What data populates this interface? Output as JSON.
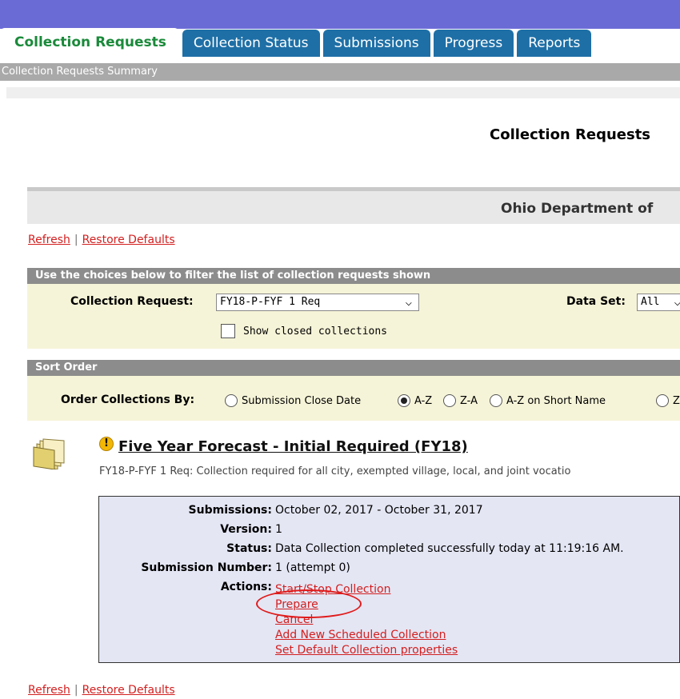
{
  "tabs": [
    {
      "label": "Collection Requests",
      "active": true
    },
    {
      "label": "Collection Status",
      "active": false
    },
    {
      "label": "Submissions",
      "active": false
    },
    {
      "label": "Progress",
      "active": false
    },
    {
      "label": "Reports",
      "active": false
    }
  ],
  "subnav": {
    "label": "Collection Requests Summary"
  },
  "page": {
    "title": "Collection Requests",
    "organization": "Ohio Department of"
  },
  "links": {
    "refresh": "Refresh",
    "separator": "|",
    "restore_defaults": "Restore Defaults"
  },
  "filter": {
    "header": "Use the choices below to filter the list of collection requests shown",
    "collection_request_label": "Collection Request:",
    "collection_request_value": "FY18-P-FYF 1 Req",
    "data_set_label": "Data Set:",
    "data_set_value": "All",
    "show_closed_label": "Show closed collections"
  },
  "sort": {
    "header": "Sort Order",
    "order_label": "Order Collections By:",
    "options": [
      "Submission Close Date",
      "A-Z",
      "Z-A",
      "A-Z on Short Name",
      "Z-"
    ],
    "selected": "A-Z"
  },
  "collection": {
    "title": "Five Year Forecast - Initial Required (FY18)",
    "description": "FY18-P-FYF 1 Req: Collection required for all city, exempted village, local, and joint vocatio",
    "details": [
      {
        "label": "Submissions:",
        "value": "October 02, 2017 - October 31, 2017"
      },
      {
        "label": "Version:",
        "value": "1"
      },
      {
        "label": "Status:",
        "value": "Data Collection completed successfully today at 11:19:16 AM."
      },
      {
        "label": "Submission Number:",
        "value": "1 (attempt 0)"
      },
      {
        "label": "Actions:",
        "value": ""
      }
    ],
    "actions": [
      "Start/Stop Collection",
      "Prepare",
      "Cancel",
      "Add New Scheduled Collection",
      "Set Default Collection properties"
    ]
  },
  "colors": {
    "link": "#d32020",
    "tab": "#1e6fa6",
    "active_tab_text": "#1a8a3a",
    "highlight": "#e01b1b",
    "warning": "#f2b705"
  },
  "icons": {
    "folder": "folder-icon",
    "warning": "warning-icon",
    "chevron": "chevron-down-icon"
  }
}
